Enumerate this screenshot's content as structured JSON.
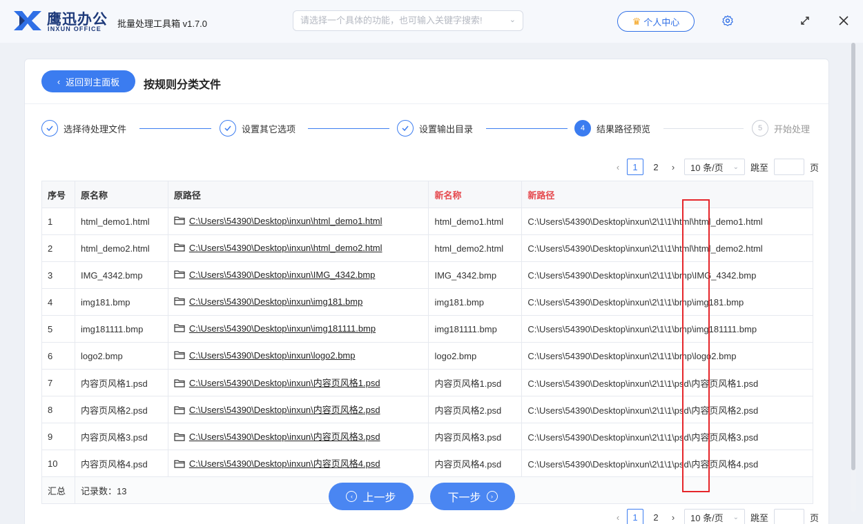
{
  "app": {
    "brand_cn": "鹰迅办公",
    "brand_en": "INXUN OFFICE",
    "title": "批量处理工具箱 v1.7.0",
    "search_placeholder": "请选择一个具体的功能，也可输入关键字搜索!",
    "user_center": "个人中心"
  },
  "header": {
    "back_label": "返回到主面板",
    "page_title": "按规则分类文件"
  },
  "steps": [
    {
      "label": "选择待处理文件",
      "state": "done"
    },
    {
      "label": "设置其它选项",
      "state": "done"
    },
    {
      "label": "设置输出目录",
      "state": "done"
    },
    {
      "label": "结果路径预览",
      "state": "active",
      "num": "4"
    },
    {
      "label": "开始处理",
      "state": "todo",
      "num": "5"
    }
  ],
  "pager": {
    "pages": [
      "1",
      "2"
    ],
    "current": "1",
    "page_size": "10 条/页",
    "jump_label": "跳至",
    "page_suffix": "页"
  },
  "table": {
    "columns": [
      "序号",
      "原名称",
      "原路径",
      "新名称",
      "新路径"
    ],
    "rows": [
      {
        "idx": "1",
        "name": "html_demo1.html",
        "path": "C:\\Users\\54390\\Desktop\\inxun\\html_demo1.html",
        "new_name": "html_demo1.html",
        "new_path": "C:\\Users\\54390\\Desktop\\inxun\\2\\1\\1\\html\\html_demo1.html"
      },
      {
        "idx": "2",
        "name": "html_demo2.html",
        "path": "C:\\Users\\54390\\Desktop\\inxun\\html_demo2.html",
        "new_name": "html_demo2.html",
        "new_path": "C:\\Users\\54390\\Desktop\\inxun\\2\\1\\1\\html\\html_demo2.html"
      },
      {
        "idx": "3",
        "name": "IMG_4342.bmp",
        "path": "C:\\Users\\54390\\Desktop\\inxun\\IMG_4342.bmp",
        "new_name": "IMG_4342.bmp",
        "new_path": "C:\\Users\\54390\\Desktop\\inxun\\2\\1\\1\\bmp\\IMG_4342.bmp"
      },
      {
        "idx": "4",
        "name": "img181.bmp",
        "path": "C:\\Users\\54390\\Desktop\\inxun\\img181.bmp",
        "new_name": "img181.bmp",
        "new_path": "C:\\Users\\54390\\Desktop\\inxun\\2\\1\\1\\bmp\\img181.bmp"
      },
      {
        "idx": "5",
        "name": "img181111.bmp",
        "path": "C:\\Users\\54390\\Desktop\\inxun\\img181111.bmp",
        "new_name": "img181111.bmp",
        "new_path": "C:\\Users\\54390\\Desktop\\inxun\\2\\1\\1\\bmp\\img181111.bmp"
      },
      {
        "idx": "6",
        "name": "logo2.bmp",
        "path": "C:\\Users\\54390\\Desktop\\inxun\\logo2.bmp",
        "new_name": "logo2.bmp",
        "new_path": "C:\\Users\\54390\\Desktop\\inxun\\2\\1\\1\\bmp\\logo2.bmp"
      },
      {
        "idx": "7",
        "name": "内容页风格1.psd",
        "path": "C:\\Users\\54390\\Desktop\\inxun\\内容页风格1.psd",
        "new_name": "内容页风格1.psd",
        "new_path": "C:\\Users\\54390\\Desktop\\inxun\\2\\1\\1\\psd\\内容页风格1.psd"
      },
      {
        "idx": "8",
        "name": "内容页风格2.psd",
        "path": "C:\\Users\\54390\\Desktop\\inxun\\内容页风格2.psd",
        "new_name": "内容页风格2.psd",
        "new_path": "C:\\Users\\54390\\Desktop\\inxun\\2\\1\\1\\psd\\内容页风格2.psd"
      },
      {
        "idx": "9",
        "name": "内容页风格3.psd",
        "path": "C:\\Users\\54390\\Desktop\\inxun\\内容页风格3.psd",
        "new_name": "内容页风格3.psd",
        "new_path": "C:\\Users\\54390\\Desktop\\inxun\\2\\1\\1\\psd\\内容页风格3.psd"
      },
      {
        "idx": "10",
        "name": "内容页风格4.psd",
        "path": "C:\\Users\\54390\\Desktop\\inxun\\内容页风格4.psd",
        "new_name": "内容页风格4.psd",
        "new_path": "C:\\Users\\54390\\Desktop\\inxun\\2\\1\\1\\psd\\内容页风格4.psd"
      }
    ],
    "summary_label": "汇总",
    "summary_text": "记录数：13"
  },
  "nav": {
    "prev_label": "上一步",
    "next_label": "下一步"
  },
  "colors": {
    "accent": "#3b7cf0",
    "red_header": "#e5484d",
    "highlight_box": "#e5252a"
  }
}
